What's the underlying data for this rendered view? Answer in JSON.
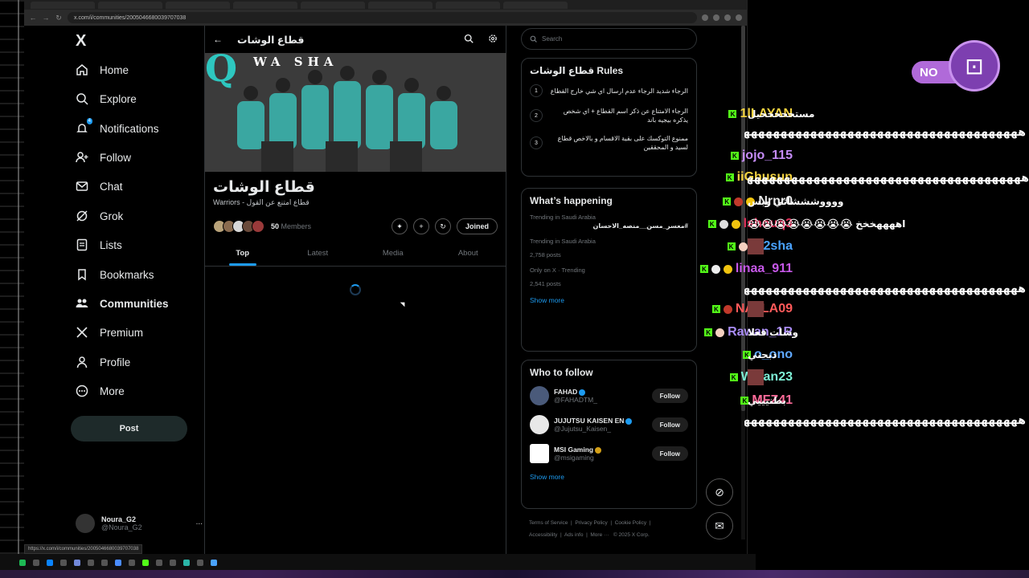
{
  "browser": {
    "url": "x.com/i/communities/2005046680039707038",
    "status_url": "https://x.com/i/communities/2005046680039707038"
  },
  "nav": {
    "logo": "X",
    "items": [
      {
        "label": "Home",
        "icon": "home-icon"
      },
      {
        "label": "Explore",
        "icon": "search-icon"
      },
      {
        "label": "Notifications",
        "icon": "bell-icon",
        "badge": "4"
      },
      {
        "label": "Follow",
        "icon": "person-add-icon"
      },
      {
        "label": "Chat",
        "icon": "mail-icon"
      },
      {
        "label": "Grok",
        "icon": "grok-icon"
      },
      {
        "label": "Lists",
        "icon": "list-icon"
      },
      {
        "label": "Bookmarks",
        "icon": "bookmark-icon"
      },
      {
        "label": "Communities",
        "icon": "people-icon"
      },
      {
        "label": "Premium",
        "icon": "x-icon"
      },
      {
        "label": "Profile",
        "icon": "person-icon"
      },
      {
        "label": "More",
        "icon": "more-circle-icon"
      }
    ],
    "post_label": "Post",
    "account": {
      "name": "Noura_G2",
      "handle": "@Noura_G2",
      "more": "..."
    }
  },
  "community": {
    "header_title": "قطاع الوشات",
    "banner_text": "WA SHA",
    "banner_letter": "Q",
    "name": "قطاع الوشات",
    "tagline": "Warriors - قطاع امتنع عن القول",
    "member_count": "50",
    "members_label": "Members",
    "joined_label": "Joined",
    "tabs": [
      "Top",
      "Latest",
      "Media",
      "About"
    ]
  },
  "sidebar": {
    "search_placeholder": "Search",
    "rules": {
      "title": "قطاع الوشات Rules",
      "items": [
        {
          "num": "1",
          "text": "الرجاء شديد الرجاء عدم ارسال اي شي خارج القطاع"
        },
        {
          "num": "2",
          "text": "الرجاء الامتناع عن ذكر اسم القطاع + اي شخص يذكره بيجيه باند"
        },
        {
          "num": "3",
          "text": "ممنوع التوكسك على بقية الاقسام و بالاخص قطاع لسيد و المحققين"
        }
      ]
    },
    "happening": {
      "title": "What’s happening",
      "trends": [
        {
          "context": "Trending in Saudi Arabia",
          "topic": "#معسر_مسن__منصه_الاحسان",
          "count": ""
        },
        {
          "context": "Trending in Saudi Arabia",
          "topic": "",
          "count": "2,758 posts"
        },
        {
          "context": "Only on X · Trending",
          "topic": "",
          "count": "2,541 posts"
        }
      ],
      "show_more": "Show more"
    },
    "who_to_follow": {
      "title": "Who to follow",
      "accounts": [
        {
          "name": "FAHAD",
          "handle": "@FAHADTM_",
          "badge": "blue"
        },
        {
          "name": "JUJUTSU KAISEN EN",
          "handle": "@Jujutsu_Kaisen_",
          "badge": "blue"
        },
        {
          "name": "MSI Gaming",
          "handle": "@msigaming",
          "badge": "gold"
        }
      ],
      "follow_label": "Follow",
      "show_more": "Show more"
    },
    "footer": {
      "links": [
        "Terms of Service",
        "Privacy Policy",
        "Cookie Policy",
        "Accessibility",
        "Ads info",
        "More ···"
      ],
      "copyright": "© 2025 X Corp."
    }
  },
  "chat": {
    "logo_text": "NO",
    "lines": [
      {
        "user": "1lLAYAN",
        "color": "#f3d23f",
        "msg": "مستحححححيل"
      },
      {
        "user": "jojo_115",
        "color": "#c58cf7",
        "msg": ""
      },
      {
        "user": "iiGhusun",
        "color": "#f3d23f",
        "msg": ""
      },
      {
        "user": "Nrnr0",
        "color": "#e9e9e9",
        "msg": "ووووشششاتي وبس"
      },
      {
        "user": "lshouq3",
        "color": "#e0305a",
        "msg": "اههههخخخ"
      },
      {
        "user": "Ai2sha",
        "color": "#4aa3ff",
        "msg": ""
      },
      {
        "user": "linaa_911",
        "color": "#c658e8",
        "msg": ""
      },
      {
        "user": "NAJLA09",
        "color": "#ff5a5a",
        "msg": ""
      },
      {
        "user": "Rawan_1R",
        "color": "#a98cf5",
        "msg": "وشات فعلا"
      },
      {
        "user": "o_ono",
        "color": "#5fa8ff",
        "msg": "ذبحني"
      },
      {
        "user": "Wajan23",
        "color": "#7ef0d6",
        "msg": ""
      },
      {
        "user": "MFZ41",
        "color": "#ff6b9a",
        "msg": "بطنيييي"
      }
    ],
    "long_msg": "هههههههههههههههههههههههههههههههههههههههههههههههههههههههههههههههه"
  }
}
